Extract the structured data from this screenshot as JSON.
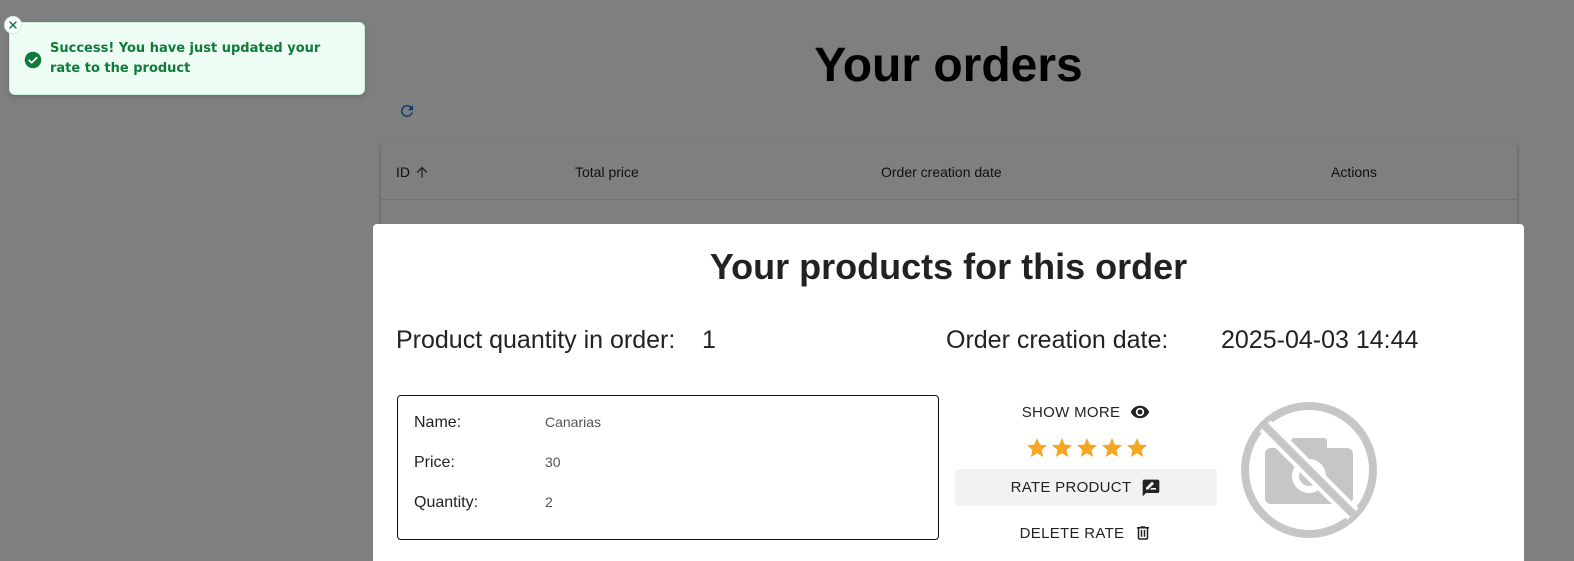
{
  "page": {
    "title": "Your orders",
    "table": {
      "columns": [
        {
          "label": "ID",
          "sorted": "ascending"
        },
        {
          "label": "Total price"
        },
        {
          "label": "Order creation date"
        },
        {
          "label": "Actions"
        }
      ]
    }
  },
  "modal": {
    "title": "Your products for this order",
    "quantity_label": "Product quantity in order:",
    "quantity_value": "1",
    "date_label": "Order creation date:",
    "date_value": "2025-04-03 14:44",
    "product": {
      "name_label": "Name:",
      "name_value": "Canarias",
      "price_label": "Price:",
      "price_value": "30",
      "quantity_label": "Quantity:",
      "quantity_value": "2"
    },
    "show_more_label": "SHOW MORE",
    "rating": 5,
    "rate_product_label": "RATE PRODUCT",
    "delete_rate_label": "DELETE RATE",
    "image_icon": "no-photo-icon"
  },
  "toast": {
    "type": "success",
    "message": "Success! You have just updated your rate to the product"
  },
  "colors": {
    "success_text": "#0f7a3c",
    "success_bg": "#edfdf4",
    "star": "#f5a623",
    "refresh": "#1976d2",
    "overlay": "rgba(0,0,0,0.5)"
  }
}
